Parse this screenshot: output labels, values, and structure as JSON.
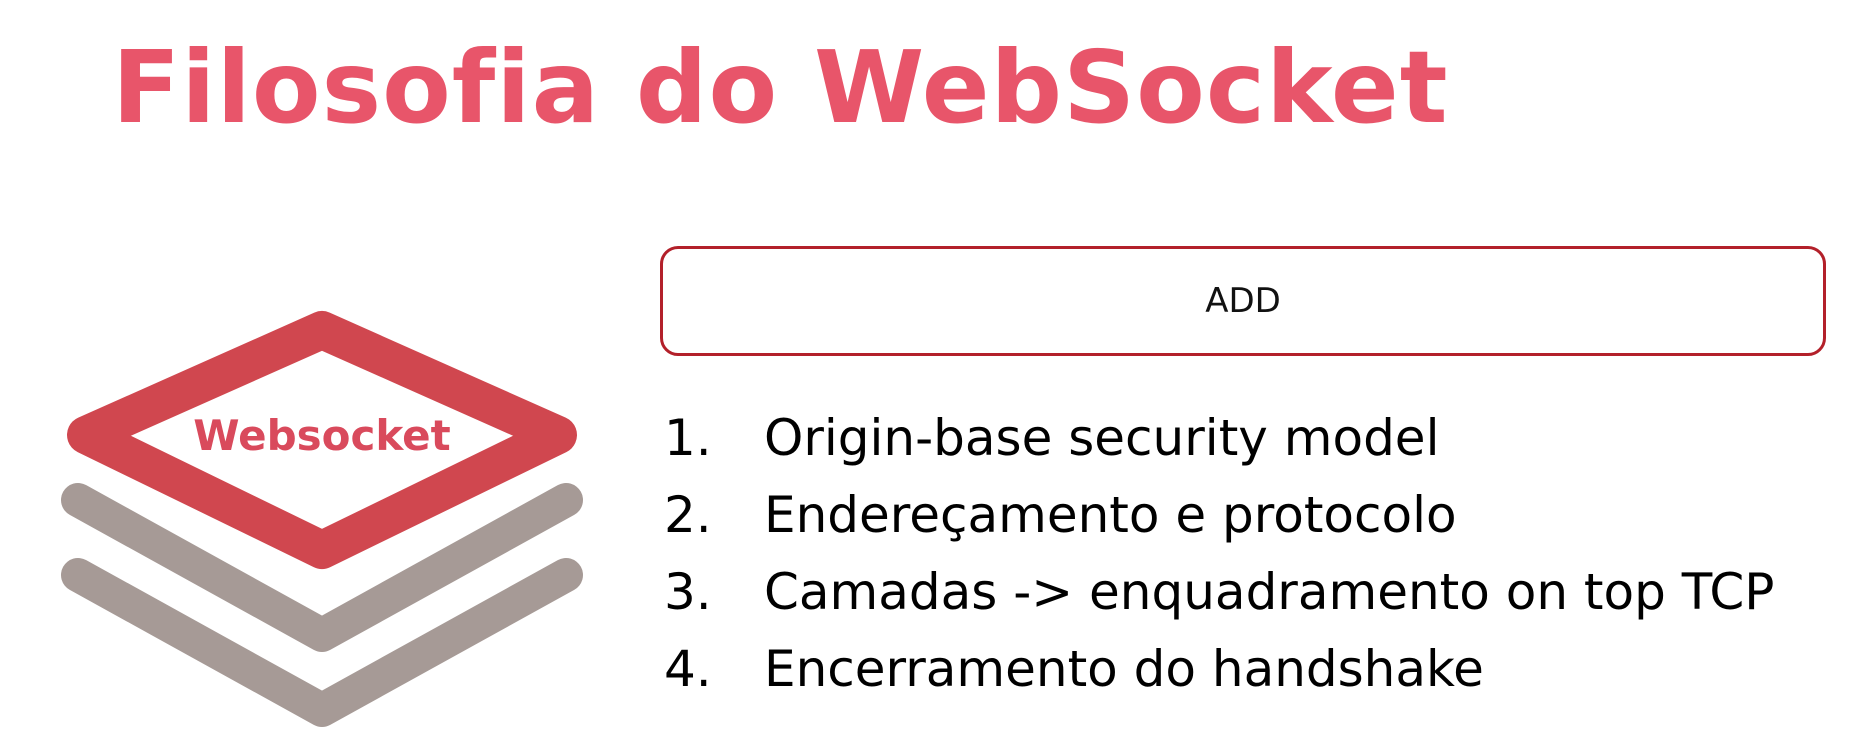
{
  "slide": {
    "title": "Filosofia do WebSocket",
    "logo_label": "Websocket",
    "add_box_label": "ADD",
    "items": [
      {
        "num": "1.",
        "text": "Origin-base security model"
      },
      {
        "num": "2.",
        "text": "Endereçamento e protocolo"
      },
      {
        "num": "3.",
        "text": "Camadas -> enquadramento on top TCP"
      },
      {
        "num": "4.",
        "text": "Encerramento do handshake"
      }
    ]
  },
  "colors": {
    "title": "#e8556a",
    "logo_top_layer": "#d0474f",
    "logo_lower_layers": "#a69a96",
    "box_border": "#b3202a"
  },
  "icons": {
    "logo": "stacked-layers-icon"
  }
}
